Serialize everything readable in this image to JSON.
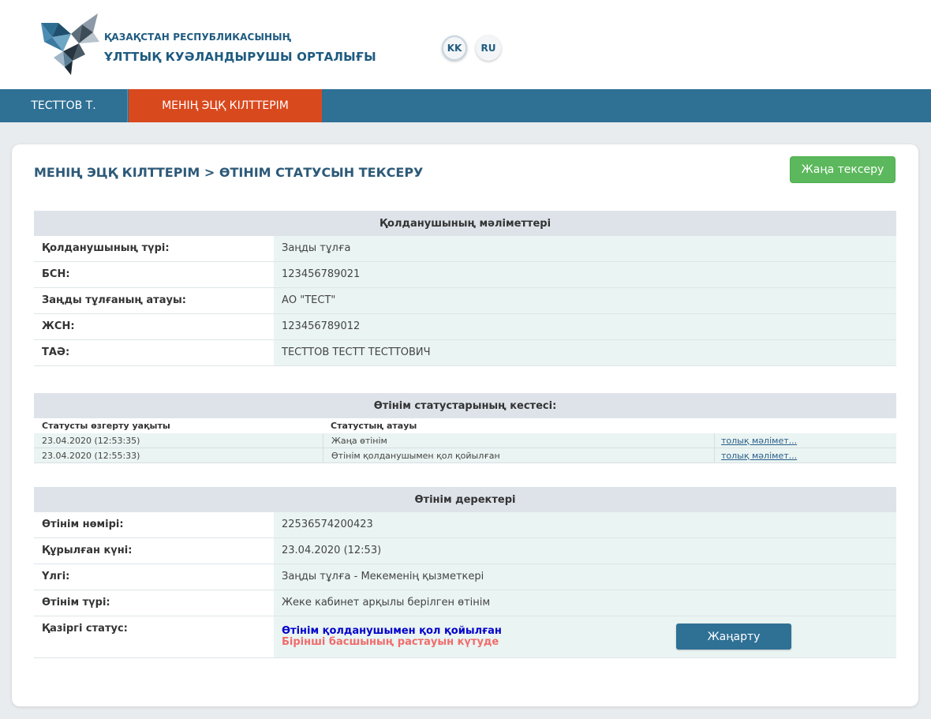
{
  "header": {
    "org_line1": "ҚАЗАҚСТАН РЕСПУБЛИКАСЫНЫҢ",
    "org_line2": "ҰЛТТЫҚ КУӘЛАНДЫРУШЫ ОРТАЛЫҒЫ",
    "lang_kk": "KK",
    "lang_ru": "RU"
  },
  "nav": {
    "user": "ТЕСТТОВ Т.",
    "keys": "МЕНІҢ ЭЦҚ КІЛТТЕРІМ"
  },
  "page": {
    "breadcrumb": "МЕНІҢ ЭЦҚ КІЛТТЕРІМ > ӨТІНІМ СТАТУСЫН ТЕКСЕРУ",
    "new_check_button": "Жаңа тексеру"
  },
  "user_info": {
    "title": "Қолданушының мәліметтері",
    "rows": [
      {
        "label": "Қолданушының түрі:",
        "value": "Заңды тұлға"
      },
      {
        "label": "БСН:",
        "value": "123456789021"
      },
      {
        "label": "Заңды тұлғаның атауы:",
        "value": "АО \"ТЕСТ\""
      },
      {
        "label": "ЖСН:",
        "value": "123456789012"
      },
      {
        "label": "ТАӘ:",
        "value": "ТЕСТТОВ ТЕСТТ ТЕСТТОВИЧ"
      }
    ]
  },
  "status_table": {
    "title": "Өтінім статустарының кестесі:",
    "col_time": "Статусты өзгерту уақыты",
    "col_name": "Статустың атауы",
    "rows": [
      {
        "time": "23.04.2020 (12:53:35)",
        "name": "Жаңа өтінім",
        "link": "толық мәлімет..."
      },
      {
        "time": "23.04.2020 (12:55:33)",
        "name": "Өтінім қолданушымен қол қойылған",
        "link": "толық мәлімет..."
      }
    ]
  },
  "request_info": {
    "title": "Өтінім деректері",
    "rows": [
      {
        "label": "Өтінім нөмірі:",
        "value": "22536574200423"
      },
      {
        "label": "Құрылған күні:",
        "value": "23.04.2020 (12:53)"
      },
      {
        "label": "Үлгі:",
        "value": "Заңды тұлға - Мекеменің қызметкері"
      },
      {
        "label": "Өтінім түрі:",
        "value": "Жеке кабинет арқылы берілген өтінім"
      }
    ],
    "status_label": "Қазіргі статус:",
    "status_main": "Өтінім қолданушымен қол қойылған",
    "status_sub": "Бірінші басшының растауын күтуде",
    "refresh_button": "Жаңарту"
  },
  "colors": {
    "nav_bg": "#2f7095",
    "nav_active": "#d9491e",
    "btn_green": "#5cb85c",
    "status_blue": "#0000cc",
    "status_red": "#f06c6c"
  }
}
